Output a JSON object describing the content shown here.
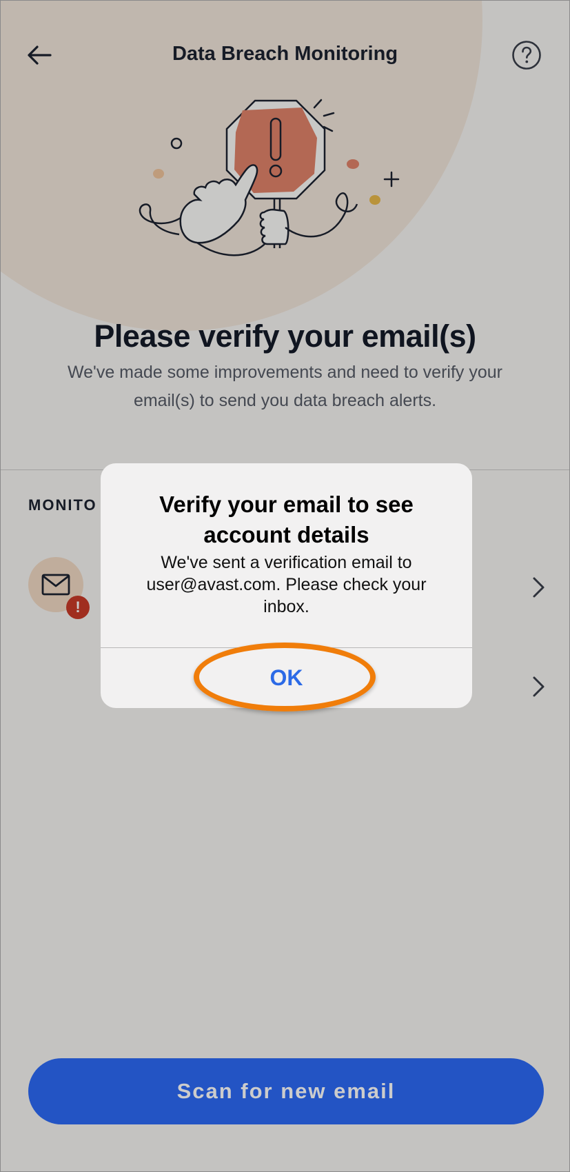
{
  "header": {
    "title": "Data Breach Monitoring",
    "back_icon": "arrow-left-icon",
    "help_icon": "question-circle-icon"
  },
  "hero": {
    "illustration": "stop-sign-hand-illustration",
    "heading": "Please verify your email(s)",
    "description": "We've made some improvements and need to verify your email(s) to send you data breach alerts."
  },
  "monitored": {
    "section_label": "MONITO",
    "rows": [
      {
        "icon": "envelope-icon",
        "badge": "!",
        "chevron_icon": "chevron-right-icon"
      },
      {
        "chevron_icon": "chevron-right-icon"
      }
    ]
  },
  "footer": {
    "scan_button_label": "Scan for new email"
  },
  "dialog": {
    "title": "Verify your email to see account details",
    "message": "We've sent a verification email to user@avast.com. Please check your inbox.",
    "ok_label": "OK"
  },
  "colors": {
    "primary": "#2c6af5",
    "alert": "#c83a27",
    "highlight_ring": "#f07d0a",
    "avatar_bg": "#f0d9c4"
  }
}
